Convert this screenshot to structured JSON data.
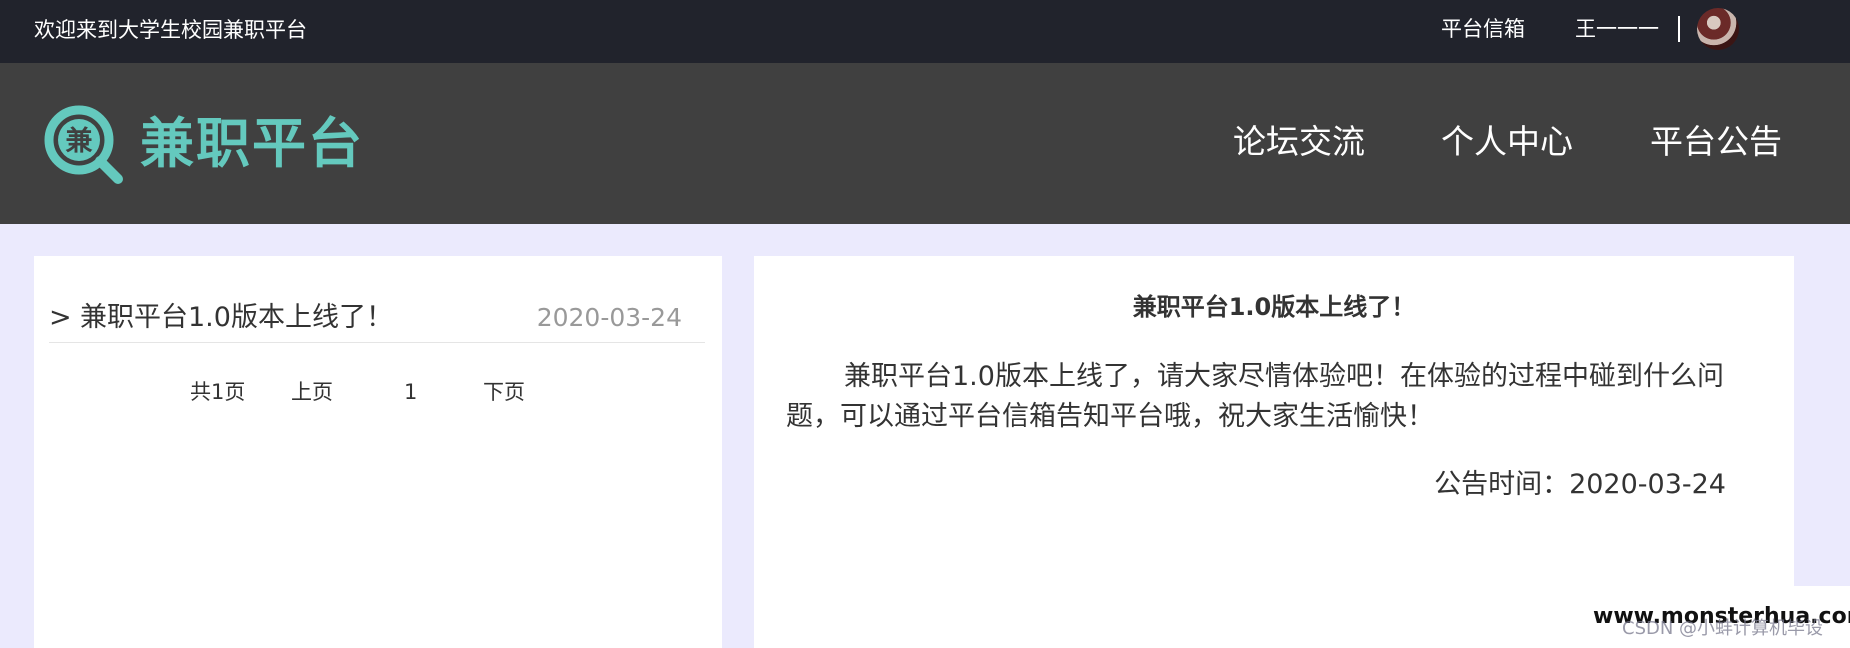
{
  "topbar": {
    "welcome": "欢迎来到大学生校园兼职平台",
    "mailbox": "平台信箱",
    "username": "王一一一"
  },
  "header": {
    "logo_glyph": "兼",
    "logo_text": "兼职平台",
    "nav": {
      "forum": "论坛交流",
      "personal": "个人中心",
      "notice": "平台公告"
    }
  },
  "notice_list": {
    "items": [
      {
        "arrow": ">",
        "title": "兼职平台1.0版本上线了！",
        "date": "2020-03-24"
      }
    ],
    "pager": {
      "total": "共1页",
      "prev": "上页",
      "current": "1",
      "next": "下页"
    }
  },
  "notice_detail": {
    "title": "兼职平台1.0版本上线了！",
    "body": "兼职平台1.0版本上线了，请大家尽情体验吧！在体验的过程中碰到什么问题，可以通过平台信箱告知平台哦，祝大家生活愉快！",
    "time": "公告时间：2020-03-24"
  },
  "watermark": {
    "site": "www.monsterhua.com",
    "csdn": "CSDN @小蚌计算机毕设"
  },
  "colors": {
    "topbar_bg": "#21232c",
    "header_bg": "#404040",
    "accent": "#64c9be",
    "page_bg": "#ebeafd"
  }
}
